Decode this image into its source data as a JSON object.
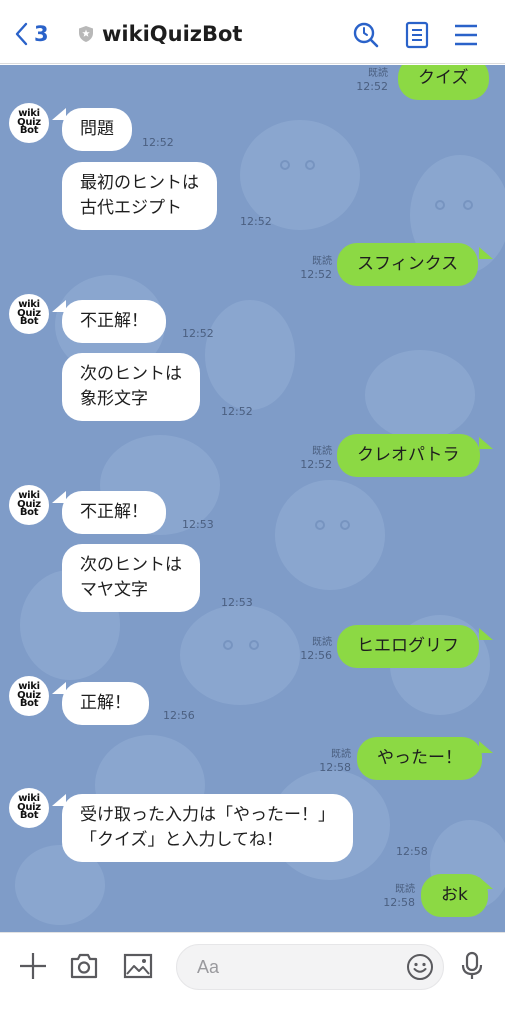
{
  "header": {
    "back_count": "3",
    "title": "wikiQuizBot"
  },
  "bot": {
    "avatar_lines": [
      "wiki",
      "Quiz",
      "Bot"
    ]
  },
  "messages": [
    {
      "side": "out",
      "text": "クイズ",
      "time": "12:52",
      "read": "既読"
    },
    {
      "side": "in",
      "text": "問題",
      "time": "12:52"
    },
    {
      "side": "in",
      "line1": "最初のヒントは",
      "line2": "古代エジプト",
      "time": "12:52"
    },
    {
      "side": "out",
      "text": "スフィンクス",
      "time": "12:52",
      "read": "既読"
    },
    {
      "side": "in",
      "text": "不正解！",
      "time": "12:52"
    },
    {
      "side": "in",
      "line1": "次のヒントは",
      "line2": "象形文字",
      "time": "12:52"
    },
    {
      "side": "out",
      "text": "クレオパトラ",
      "time": "12:52",
      "read": "既読"
    },
    {
      "side": "in",
      "text": "不正解！",
      "time": "12:53"
    },
    {
      "side": "in",
      "line1": "次のヒントは",
      "line2": "マヤ文字",
      "time": "12:53"
    },
    {
      "side": "out",
      "text": "ヒエログリフ",
      "time": "12:56",
      "read": "既読"
    },
    {
      "side": "in",
      "text": "正解！",
      "time": "12:56"
    },
    {
      "side": "out",
      "text": "やったー！",
      "time": "12:58",
      "read": "既読"
    },
    {
      "side": "in",
      "line1": "受け取った入力は「やったー！」",
      "line2": "「クイズ」と入力してね！",
      "time": "12:58"
    },
    {
      "side": "out",
      "text": "おk",
      "time": "12:58",
      "read": "既読"
    }
  ],
  "composer": {
    "placeholder": "Aa"
  },
  "icons": {
    "back": "chevron-left-icon",
    "verified": "shield-badge-icon",
    "search": "search-icon",
    "notes": "notes-icon",
    "menu": "hamburger-menu-icon",
    "add": "plus-icon",
    "camera": "camera-icon",
    "image": "image-icon",
    "emoji": "emoji-icon",
    "mic": "microphone-icon"
  },
  "colors": {
    "accent": "#2a62c9",
    "chat_bg": "#7f9cc8",
    "outgoing_bubble": "#8cd944",
    "incoming_bubble": "#ffffff"
  }
}
